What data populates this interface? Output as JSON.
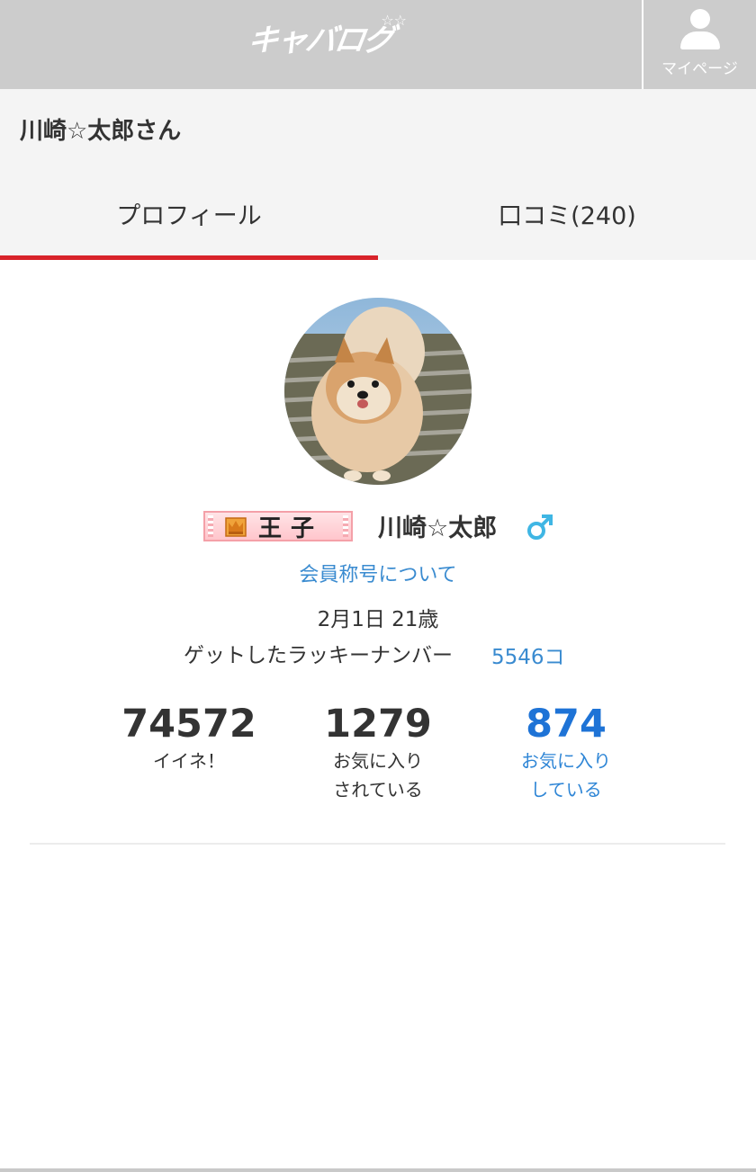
{
  "header": {
    "logo_text": "キャバログ",
    "logo_stars": "☆☆",
    "mypage_label": "マイページ",
    "mypage_icon": "person-icon",
    "background": "#cccccc"
  },
  "user": {
    "page_title": "川崎☆太郎さん",
    "display_name": "川崎☆太郎",
    "rank_label": "王子",
    "rank_icon": "crown-icon",
    "gender_icon": "male-icon",
    "gender_color": "#3fb6e4",
    "title_link": "会員称号について",
    "birthday": "2月1日 21歳",
    "lucky_label": "ゲットしたラッキーナンバー",
    "lucky_count": "5546コ"
  },
  "tabs": [
    {
      "label": "プロフィール",
      "active": true
    },
    {
      "label": "口コミ(240)",
      "active": false
    }
  ],
  "stats": [
    {
      "value": "74572",
      "label_line1": "イイネ！",
      "label_line2": ""
    },
    {
      "value": "1279",
      "label_line1": "お気に入り",
      "label_line2": "されている"
    },
    {
      "value": "874",
      "label_line1": "お気に入り",
      "label_line2": "している"
    }
  ],
  "colors": {
    "accent_red": "#d8232a",
    "link_blue": "#3a8bd0",
    "stat_blue": "#1e73d6"
  }
}
